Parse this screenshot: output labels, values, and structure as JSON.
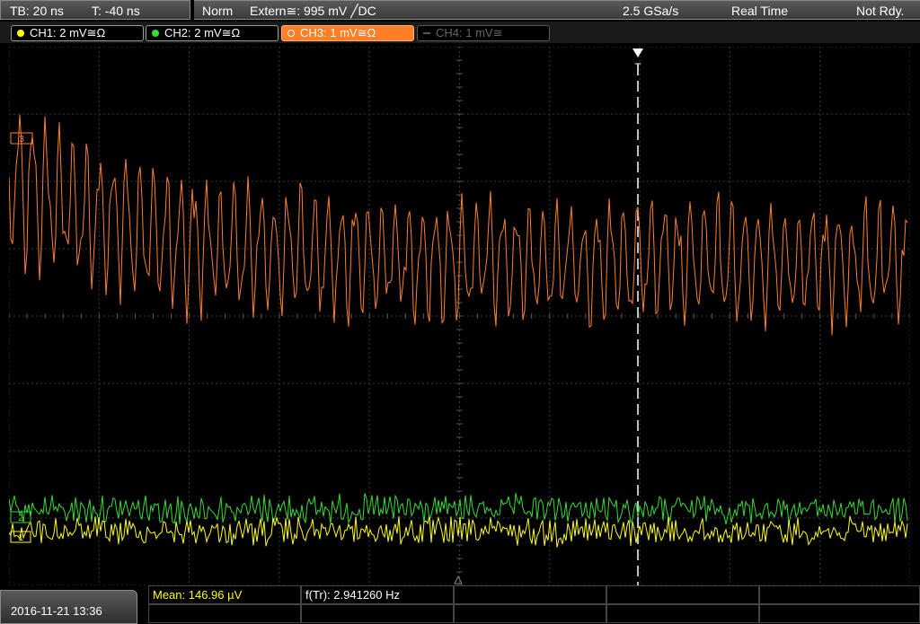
{
  "timebase": {
    "tb_label": "TB: 20 ns",
    "trig_offset_label": "T: -40 ns"
  },
  "status": {
    "mode": "Norm",
    "trigger_source": "Extern≅: 995 mV ╱DC",
    "sample_rate": "2.5 GSa/s",
    "acq_mode": "Real Time",
    "state": "Not Rdy."
  },
  "channels": [
    {
      "label": "CH1: 2 mV≅Ω",
      "color": "#ffff00",
      "active": true,
      "selected": false
    },
    {
      "label": "CH2: 2 mV≅Ω",
      "color": "#33dd33",
      "active": true,
      "selected": false
    },
    {
      "label": "CH3: 1 mV≅Ω",
      "color": "#ff7f27",
      "active": true,
      "selected": true
    },
    {
      "label": "CH4: 1 mV≅",
      "color": "#666666",
      "active": false,
      "selected": false
    }
  ],
  "trigger_marker": {
    "label": "T",
    "icon": "trigger-arrow-icon"
  },
  "channel_markers": {
    "ch3": "3",
    "ch1": "1",
    "ch2": "2"
  },
  "measurements": {
    "mean": "Mean: 146.96 µV",
    "freq": "f(Tr): 2.941260 Hz"
  },
  "datetime": "2016-11-21 13:36",
  "colors": {
    "ch1": "#ffff00",
    "ch2": "#33dd33",
    "ch3": "#ff7f27",
    "grid": "#3a3a3a",
    "trigger_line": "#ffffff"
  }
}
